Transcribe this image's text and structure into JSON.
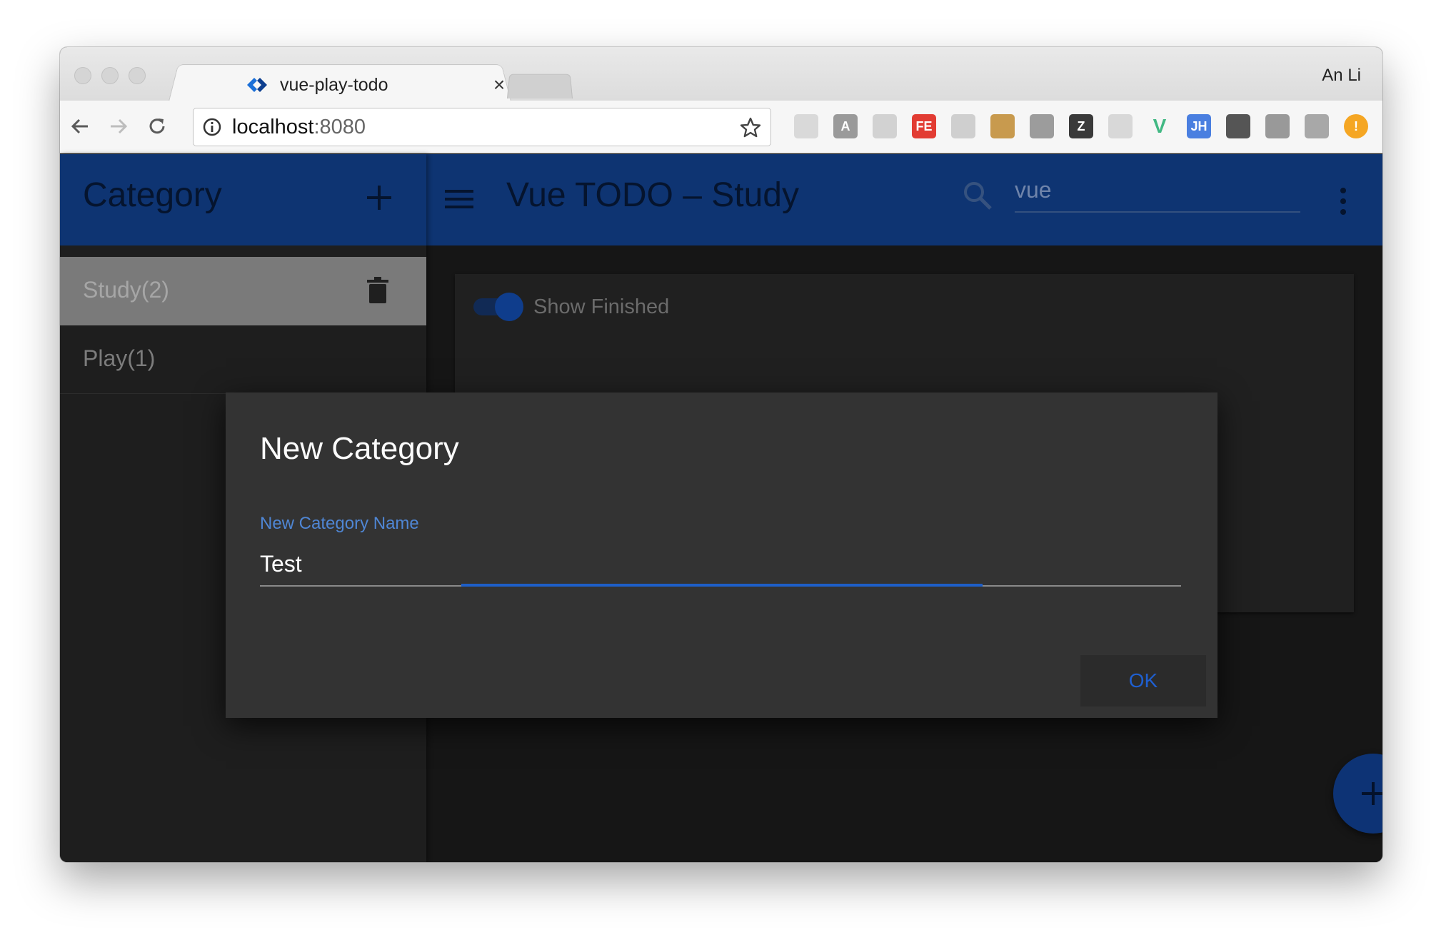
{
  "browser": {
    "tab_title": "vue-play-todo",
    "tab_close": "×",
    "profile_name": "An Li",
    "url_host": "localhost",
    "url_port": ":8080",
    "extensions": [
      {
        "name": "ext-1-icon",
        "label": ""
      },
      {
        "name": "angular-icon",
        "label": "A"
      },
      {
        "name": "ext-3-icon",
        "label": ""
      },
      {
        "name": "fe-icon",
        "label": "FE"
      },
      {
        "name": "ext-5-icon",
        "label": ""
      },
      {
        "name": "ext-6-icon",
        "label": ""
      },
      {
        "name": "react-icon",
        "label": ""
      },
      {
        "name": "z-icon",
        "label": "Z"
      },
      {
        "name": "ext-9-icon",
        "label": ""
      },
      {
        "name": "vue-icon",
        "label": "V"
      },
      {
        "name": "jh-icon",
        "label": "JH"
      },
      {
        "name": "camera-icon",
        "label": ""
      },
      {
        "name": "ext-13-icon",
        "label": ""
      },
      {
        "name": "ext-14-icon",
        "label": ""
      },
      {
        "name": "warning-icon",
        "label": "!"
      }
    ]
  },
  "sidebar": {
    "title": "Category",
    "items": [
      {
        "label": "Study(2)",
        "active": true
      },
      {
        "label": "Play(1)",
        "active": false
      }
    ]
  },
  "appbar": {
    "title": "Vue TODO – Study",
    "search_value": "vue"
  },
  "content": {
    "toggle_label": "Show Finished",
    "toggle_on": true
  },
  "dialog": {
    "title": "New Category",
    "field_label": "New Category Name",
    "field_value": "Test",
    "ok_label": "OK"
  },
  "colors": {
    "primary": "#0e3472",
    "accent": "#1e5fc8",
    "dialog_bg": "#333333"
  }
}
